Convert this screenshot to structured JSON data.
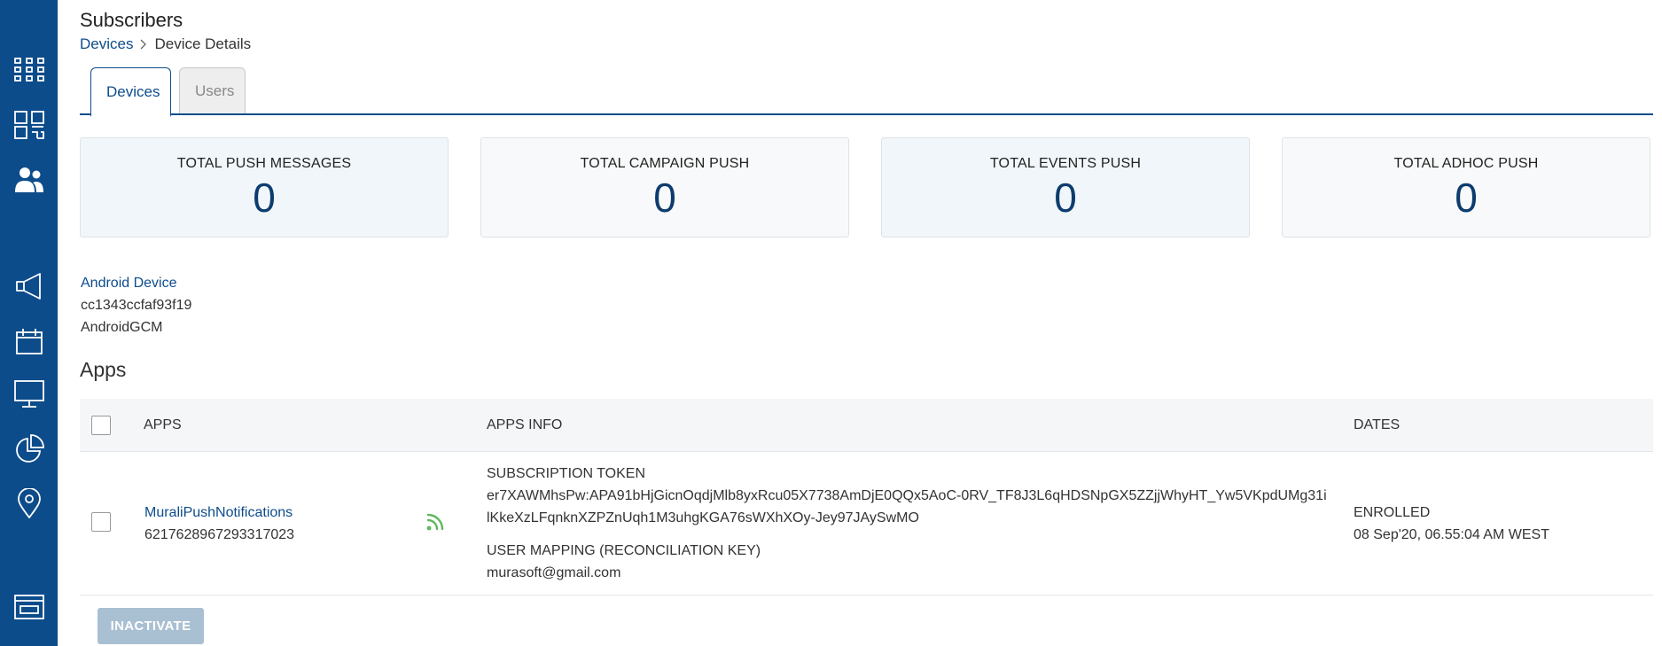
{
  "page": {
    "title": "Subscribers"
  },
  "breadcrumb": {
    "parent": "Devices",
    "current": "Device Details"
  },
  "tabs": [
    {
      "label": "Devices",
      "active": true
    },
    {
      "label": "Users",
      "active": false
    }
  ],
  "stats": [
    {
      "label": "TOTAL PUSH MESSAGES",
      "value": "0"
    },
    {
      "label": "TOTAL CAMPAIGN PUSH",
      "value": "0"
    },
    {
      "label": "TOTAL EVENTS PUSH",
      "value": "0"
    },
    {
      "label": "TOTAL ADHOC PUSH",
      "value": "0"
    }
  ],
  "device": {
    "type": "Android Device",
    "id": "cc1343ccfaf93f19",
    "platform": "AndroidGCM"
  },
  "apps_section": {
    "title": "Apps",
    "columns": {
      "apps": "APPS",
      "apps_info": "APPS INFO",
      "dates": "DATES"
    },
    "rows": [
      {
        "app_name": "MuraliPushNotifications",
        "app_id": "6217628967293317023",
        "status_icon": "rss-icon",
        "token_label": "SUBSCRIPTION TOKEN",
        "token_value": "er7XAWMhsPw:APA91bHjGicnOqdjMlb8yxRcu05X7738AmDjE0QQx5AoC-0RV_TF8J3L6qHDSNpGX5ZZjjWhyHT_Yw5VKpdUMg31ilKkeXzLFqnknXZPZnUqh1M3uhgKGA76sWXhXOy-Jey97JAySwMO",
        "mapping_label": "USER MAPPING (RECONCILIATION KEY)",
        "mapping_value": "murasoft@gmail.com",
        "date_label": "ENROLLED",
        "date_value": "08 Sep'20, 06.55:04 AM WEST"
      }
    ]
  },
  "actions": {
    "inactivate_label": "INACTIVATE"
  },
  "colors": {
    "sidebar": "#0d4c8b",
    "accent": "#0d4c8b",
    "stat_value": "#0d3c6e",
    "rss_icon": "#5cb85c",
    "button_disabled": "#a9bfd2"
  },
  "sidebar_icons": [
    "grid-icon",
    "dashboard-icon",
    "users-icon",
    "megaphone-icon",
    "calendar-icon",
    "monitor-icon",
    "pie-chart-icon",
    "location-pin-icon",
    "window-icon"
  ]
}
